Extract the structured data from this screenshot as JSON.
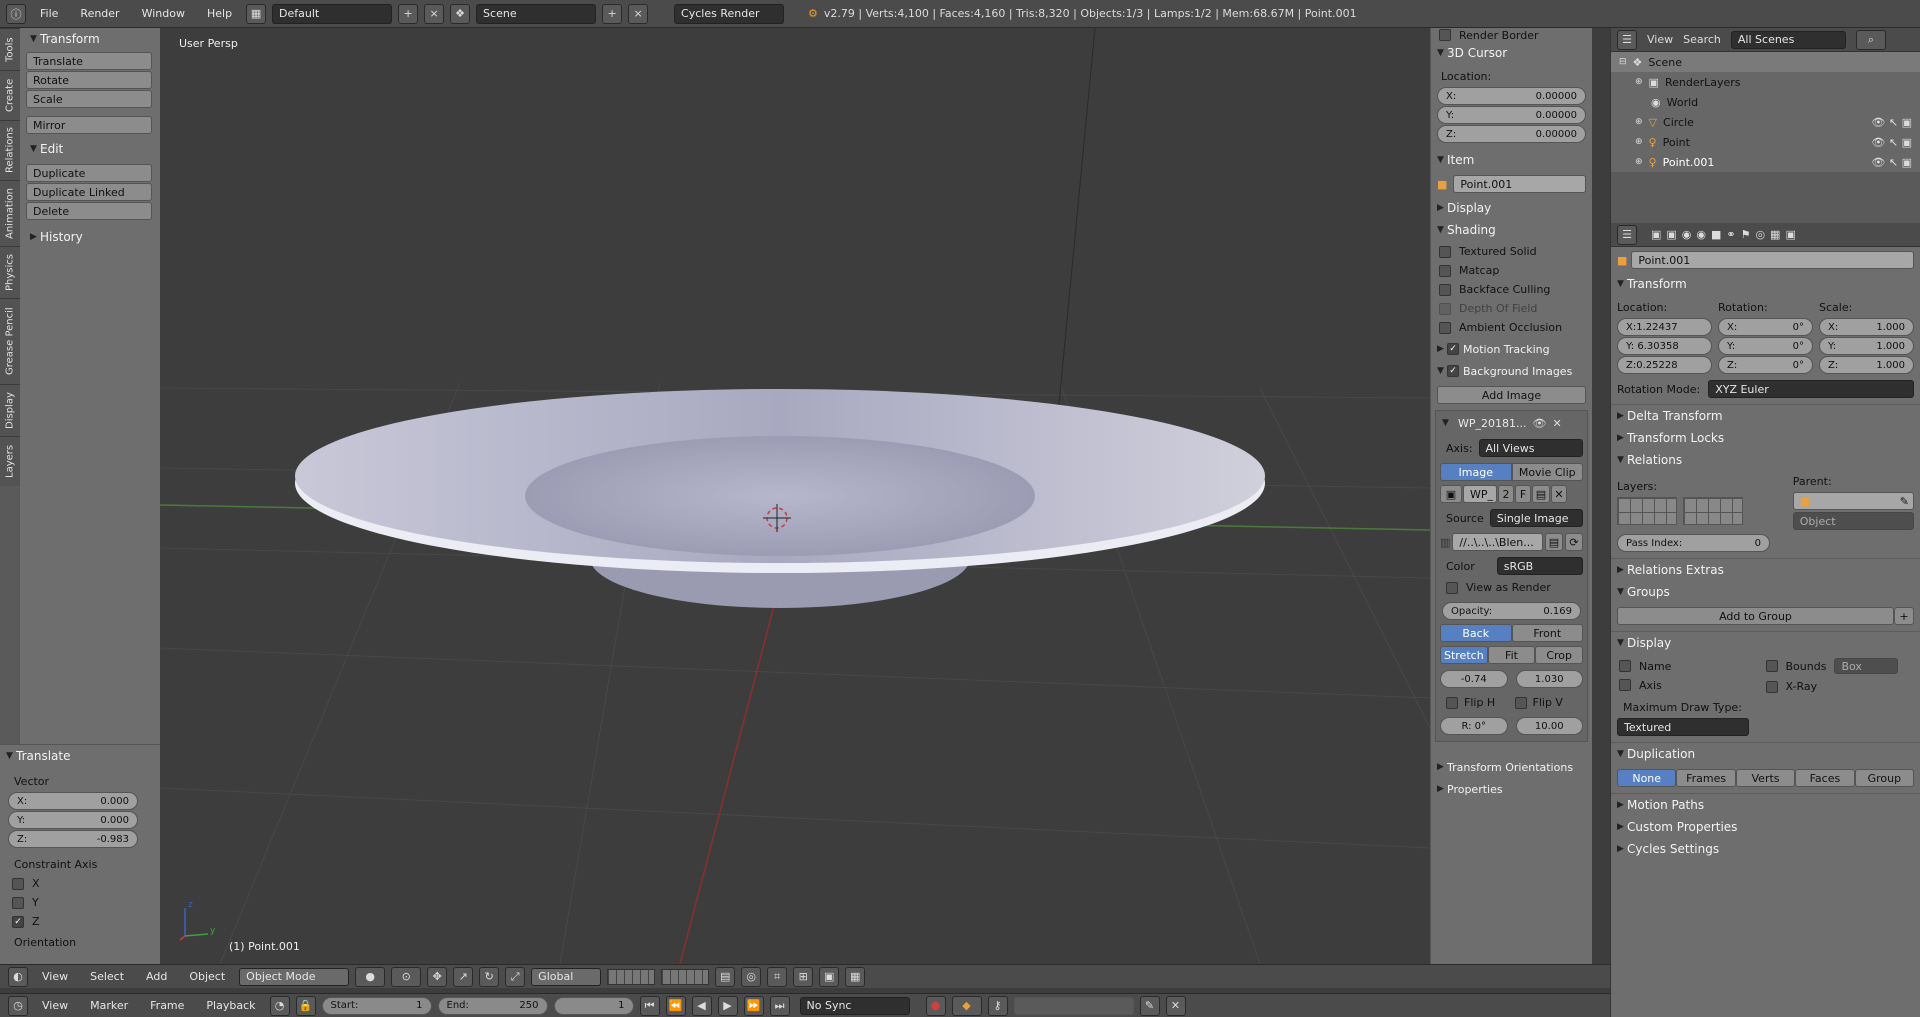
{
  "topbar": {
    "menus": [
      "File",
      "Render",
      "Window",
      "Help"
    ],
    "layout": "Default",
    "scene": "Scene",
    "engine": "Cycles Render",
    "stats": "v2.79 | Verts:4,100 | Faces:4,160 | Tris:8,320 | Objects:1/3 | Lamps:1/2 | Mem:68.67M | Point.001"
  },
  "vtabs": [
    "Tools",
    "Create",
    "Relations",
    "Animation",
    "Physics",
    "Grease Pencil",
    "Display",
    "Layers"
  ],
  "tools": {
    "transform_header": "Transform",
    "transform_buttons": [
      "Translate",
      "Rotate",
      "Scale"
    ],
    "mirror": "Mirror",
    "edit_header": "Edit",
    "edit_buttons": [
      "Duplicate",
      "Duplicate Linked",
      "Delete"
    ],
    "history_header": "History"
  },
  "operator": {
    "header": "Translate",
    "vector_label": "Vector",
    "x": "X:",
    "x_val": "0.000",
    "y": "Y:",
    "y_val": "0.000",
    "z": "Z:",
    "z_val": "-0.983",
    "constraint_label": "Constraint Axis",
    "axes": [
      "X",
      "Y",
      "Z"
    ],
    "orientation": "Orientation"
  },
  "viewport": {
    "label": "User Persp",
    "object_label": "(1) Point.001",
    "axis_y": "y",
    "axis_z": "z"
  },
  "npanel": {
    "render_border": "Render Border",
    "cursor_header": "3D Cursor",
    "location": "Location:",
    "cx": "X:",
    "cx_val": "0.00000",
    "cy": "Y:",
    "cy_val": "0.00000",
    "cz": "Z:",
    "cz_val": "0.00000",
    "item_header": "Item",
    "item_name": "Point.001",
    "display_header": "Display",
    "shading_header": "Shading",
    "shading_opts": [
      "Textured Solid",
      "Matcap",
      "Backface Culling",
      "Depth Of Field",
      "Ambient Occlusion"
    ],
    "motion_tracking": "Motion Tracking",
    "bg_images": "Background Images",
    "add_image": "Add Image",
    "image_name": "WP_20181...",
    "axis_label": "Axis:",
    "axis_value": "All Views",
    "image_tab": "Image",
    "movie_tab": "Movie Clip",
    "img_wp": "WP_",
    "img_2": "2",
    "img_f": "F",
    "source_label": "Source",
    "source_value": "Single Image",
    "path": "//..\\..\\..\\Blen...",
    "color_label": "Color",
    "color_value": "sRGB",
    "view_render": "View as Render",
    "opacity_label": "Opacity:",
    "opacity_value": "0.169",
    "back": "Back",
    "front": "Front",
    "stretch": "Stretch",
    "fit": "Fit",
    "crop": "Crop",
    "off_x": "-0.74",
    "off_y": "1.030",
    "flip_h": "Flip H",
    "flip_v": "Flip V",
    "rot": "R: 0°",
    "size": "10.00",
    "transform_orient": "Transform Orientations",
    "properties": "Properties"
  },
  "outliner": {
    "view": "View",
    "search": "Search",
    "scenes": "All Scenes",
    "items": [
      "Scene",
      "RenderLayers",
      "World",
      "Circle",
      "Point",
      "Point.001"
    ]
  },
  "props": {
    "object_name": "Point.001",
    "transform_header": "Transform",
    "location": "Location:",
    "rotation": "Rotation:",
    "scale": "Scale:",
    "loc": [
      "X:1.22437",
      "Y: 6.30358",
      "Z:0.25228"
    ],
    "rot": [
      "X:",
      "Y:",
      "Z:"
    ],
    "rot_vals": [
      "0°",
      "0°",
      "0°"
    ],
    "scl": [
      "X:",
      "Y:",
      "Z:"
    ],
    "scl_vals": [
      "1.000",
      "1.000",
      "1.000"
    ],
    "rot_mode_label": "Rotation Mode:",
    "rot_mode": "XYZ Euler",
    "delta": "Delta Transform",
    "locks": "Transform Locks",
    "relations": "Relations",
    "layers": "Layers:",
    "parent": "Parent:",
    "parent_type": "Object",
    "pass_index": "Pass Index:",
    "pass_val": "0",
    "relations_extras": "Relations Extras",
    "groups": "Groups",
    "add_group": "Add to Group",
    "display": "Display",
    "d_name": "Name",
    "d_axis": "Axis",
    "d_bounds": "Bounds",
    "d_box": "Box",
    "d_xray": "X-Ray",
    "max_draw": "Maximum Draw Type:",
    "max_draw_val": "Textured",
    "duplication": "Duplication",
    "dup_opts": [
      "None",
      "Frames",
      "Verts",
      "Faces",
      "Group"
    ],
    "motion_paths": "Motion Paths",
    "custom_props": "Custom Properties",
    "cycles": "Cycles Settings"
  },
  "header3d": {
    "menus": [
      "View",
      "Select",
      "Add",
      "Object"
    ],
    "mode": "Object Mode",
    "orientation": "Global"
  },
  "timeline": {
    "menus": [
      "View",
      "Marker",
      "Frame",
      "Playback"
    ],
    "start_label": "Start:",
    "start": "1",
    "end_label": "End:",
    "end": "250",
    "current": "1",
    "sync": "No Sync"
  }
}
